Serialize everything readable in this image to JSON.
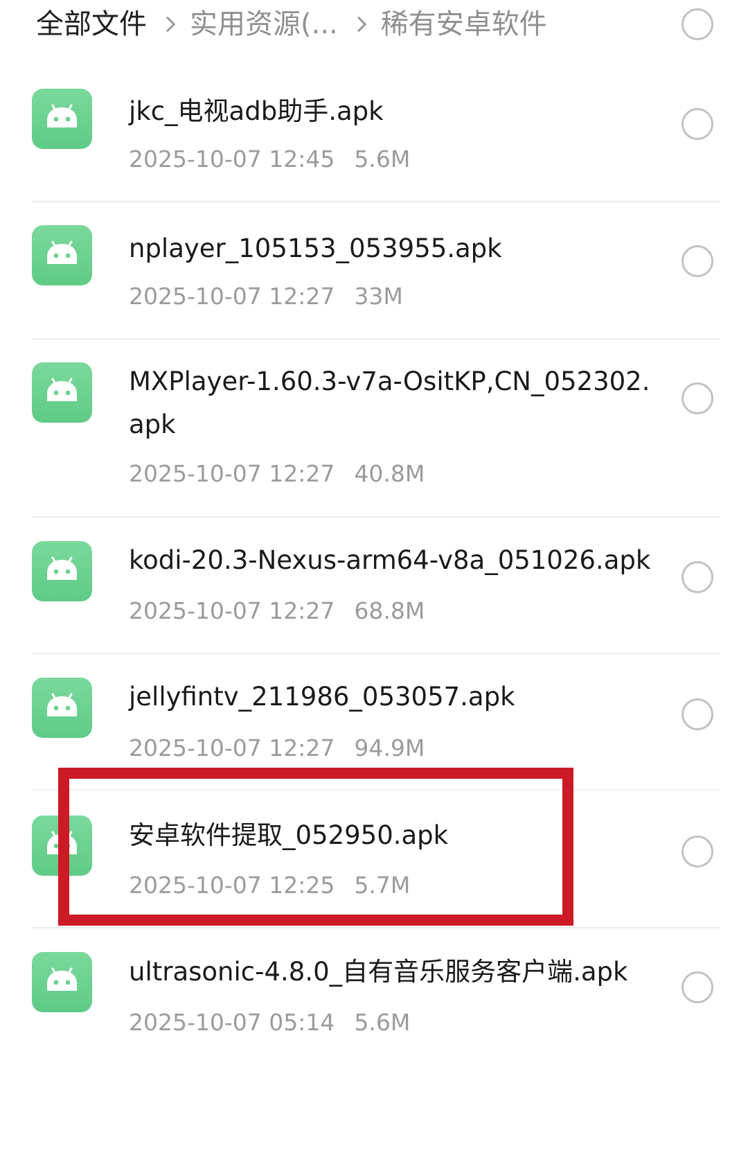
{
  "header": {
    "breadcrumb": [
      "全部文件",
      "实用资源(...",
      "稀有安卓软件"
    ]
  },
  "icons": {
    "file_icon": "android-icon",
    "chevron": "chevron-right-icon",
    "check": "circle-checkbox-icon"
  },
  "colors": {
    "icon_green": "#6ed292",
    "highlight_red": "#cc1a26"
  },
  "files": [
    {
      "name": "jkc_电视adb助手.apk",
      "date": "2025-10-07 12:45",
      "size": "5.6M"
    },
    {
      "name": "nplayer_105153_053955.apk",
      "date": "2025-10-07 12:27",
      "size": "33M"
    },
    {
      "name": "MXPlayer-1.60.3-v7a-OsitKP,CN_052302.apk",
      "date": "2025-10-07 12:27",
      "size": "40.8M"
    },
    {
      "name": "kodi-20.3-Nexus-arm64-v8a_051026.apk",
      "date": "2025-10-07 12:27",
      "size": "68.8M"
    },
    {
      "name": "jellyfintv_211986_053057.apk",
      "date": "2025-10-07 12:27",
      "size": "94.9M"
    },
    {
      "name": "安卓软件提取_052950.apk",
      "date": "2025-10-07 12:25",
      "size": "5.7M"
    },
    {
      "name": "ultrasonic-4.8.0_自有音乐服务客户端.apk",
      "date": "2025-10-07 05:14",
      "size": "5.6M"
    }
  ]
}
